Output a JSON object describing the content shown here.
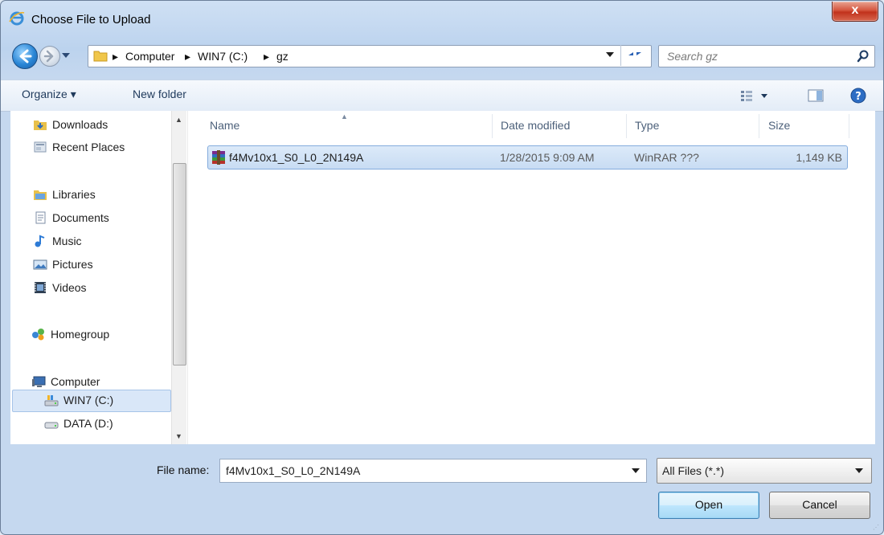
{
  "window": {
    "title": "Choose File to Upload",
    "close_label": "x"
  },
  "address": {
    "crumbs": [
      "Computer",
      "WIN7 (C:)",
      "gz"
    ],
    "separator": "▸",
    "search_placeholder": "Search gz"
  },
  "toolbar": {
    "organize_label": "Organize ▾",
    "new_folder_label": "New folder"
  },
  "nav": {
    "items": [
      {
        "label": "Downloads",
        "icon": "downloads-folder-icon"
      },
      {
        "label": "Recent Places",
        "icon": "recent-places-icon"
      },
      {
        "label": "Libraries",
        "icon": "libraries-icon"
      },
      {
        "label": "Documents",
        "icon": "documents-icon"
      },
      {
        "label": "Music",
        "icon": "music-icon"
      },
      {
        "label": "Pictures",
        "icon": "pictures-icon"
      },
      {
        "label": "Videos",
        "icon": "videos-icon"
      },
      {
        "label": "Homegroup",
        "icon": "homegroup-icon"
      },
      {
        "label": "Computer",
        "icon": "computer-icon"
      },
      {
        "label": "WIN7 (C:)",
        "icon": "drive-c-icon",
        "selected": true
      },
      {
        "label": "DATA (D:)",
        "icon": "drive-d-icon"
      }
    ]
  },
  "files": {
    "columns": [
      "Name",
      "Date modified",
      "Type",
      "Size"
    ],
    "rows": [
      {
        "name": "f4Mv10x1_S0_L0_2N149A",
        "date": "1/28/2015 9:09 AM",
        "type": "WinRAR ???",
        "size": "1,149 KB",
        "icon": "winrar-archive-icon"
      }
    ]
  },
  "footer": {
    "filename_label": "File name:",
    "filename_value": "f4Mv10x1_S0_L0_2N149A",
    "filetype_value": "All Files (*.*)",
    "open_label": "Open",
    "cancel_label": "Cancel"
  },
  "colors": {
    "selection": "#d9e7f8",
    "frame": "#bcd3ee",
    "close": "#c1321c"
  }
}
